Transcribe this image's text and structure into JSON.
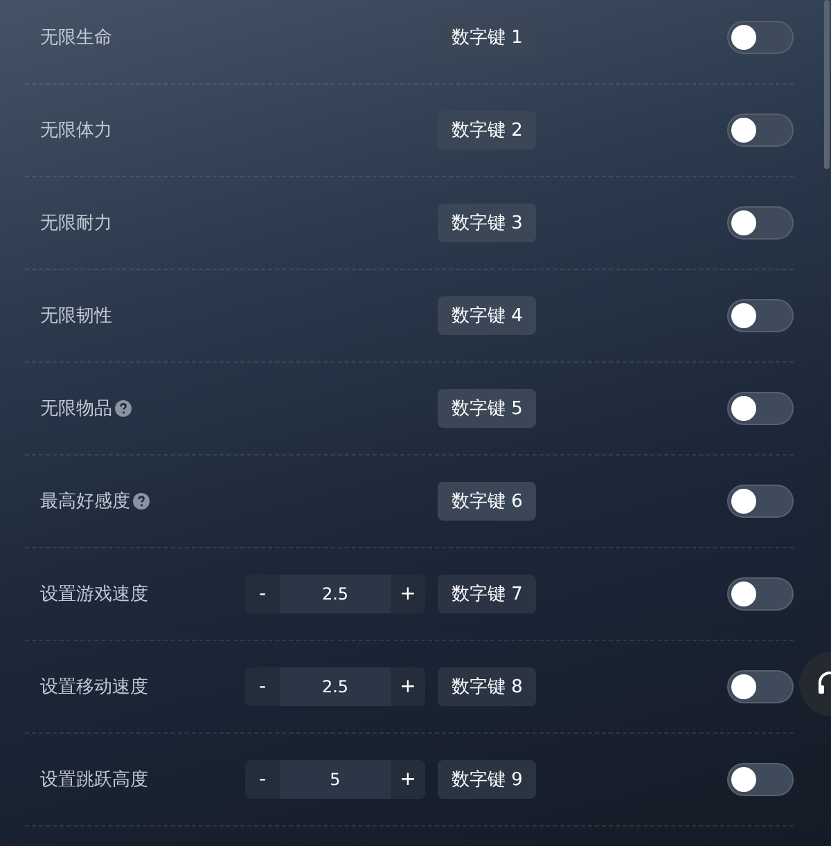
{
  "rows": [
    {
      "kind": "toggle",
      "label": "无限生命",
      "hotkey": "数字键 1",
      "on": false
    },
    {
      "kind": "toggle",
      "label": "无限体力",
      "hotkey": "数字键 2",
      "on": false
    },
    {
      "kind": "toggle",
      "label": "无限耐力",
      "hotkey": "数字键 3",
      "on": false
    },
    {
      "kind": "toggle",
      "label": "无限韧性",
      "hotkey": "数字键 4",
      "on": false
    },
    {
      "kind": "toggle",
      "label": "无限物品",
      "help": true,
      "hotkey": "数字键 5",
      "on": false
    },
    {
      "kind": "toggle",
      "label": "最高好感度",
      "help": true,
      "hotkey": "数字键 6",
      "on": false
    },
    {
      "kind": "stepper",
      "label": "设置游戏速度",
      "minus": "-",
      "value": "2.5",
      "plus": "+",
      "hotkey": "数字键 7",
      "on": false
    },
    {
      "kind": "stepper",
      "label": "设置移动速度",
      "minus": "-",
      "value": "2.5",
      "plus": "+",
      "hotkey": "数字键 8",
      "on": false
    },
    {
      "kind": "stepper",
      "label": "设置跳跃高度",
      "minus": "-",
      "value": "5",
      "plus": "+",
      "hotkey": "数字键 9",
      "on": false
    }
  ],
  "float_button": {
    "kind": "headset"
  }
}
